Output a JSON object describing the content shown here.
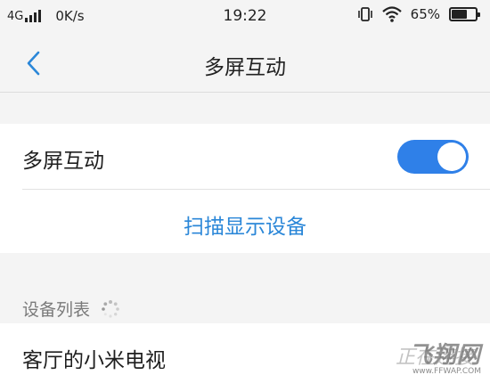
{
  "status_bar": {
    "network": "4G",
    "speed": "0K/s",
    "time": "19:22",
    "battery_percent": "65%",
    "battery_level": 0.65,
    "icons": [
      "signal-icon",
      "vibrate-icon",
      "wifi-icon",
      "battery-icon"
    ]
  },
  "nav": {
    "title": "多屏互动",
    "back_icon": "chevron-left-icon"
  },
  "settings": {
    "toggle_label": "多屏互动",
    "toggle_on": true,
    "scan_label": "扫描显示设备"
  },
  "device_list": {
    "title": "设备列表",
    "loading_icon": "spinner-icon",
    "devices": [
      {
        "name": "客厅的小米电视",
        "status": "正在连接"
      }
    ]
  },
  "watermark": {
    "logo": "飞翔网",
    "url": "www.FFWAP.COM"
  },
  "colors": {
    "accent": "#2f80e8",
    "link": "#2b87d8",
    "background": "#f4f4f4"
  }
}
